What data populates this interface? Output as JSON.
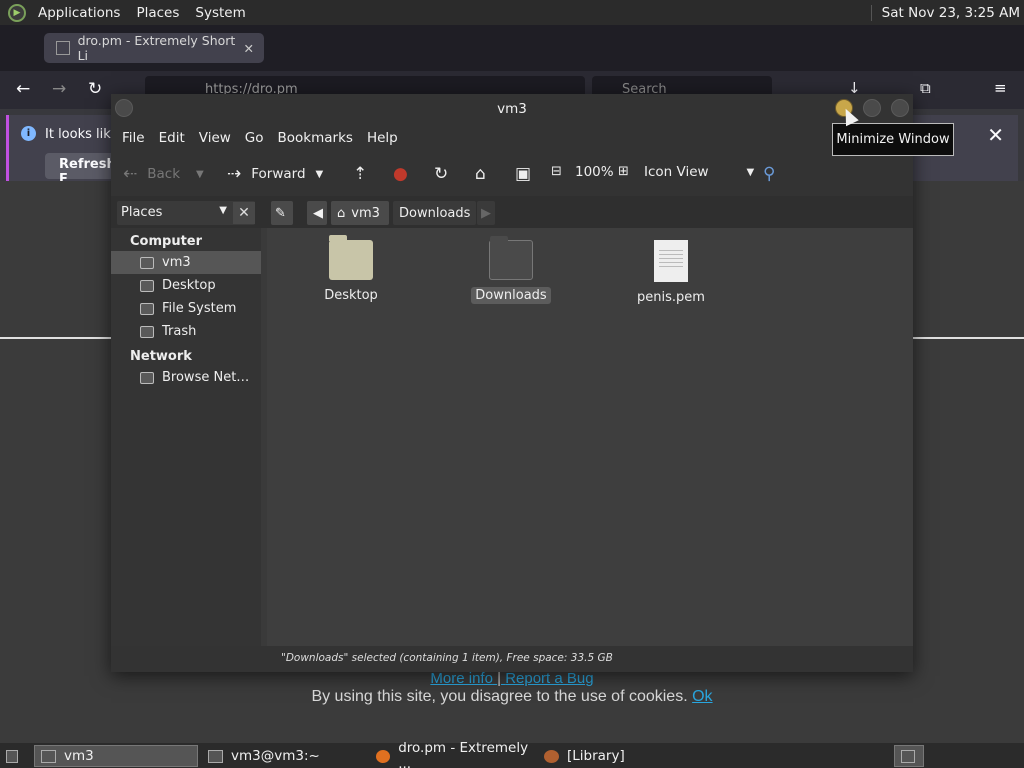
{
  "top_panel": {
    "menus": [
      "Applications",
      "Places",
      "System"
    ],
    "clock": "Sat Nov 23,  3:25 AM"
  },
  "browser": {
    "tab_title": "dro.pm - Extremely Short Li",
    "url": "https://dro.pm",
    "search_placeholder": "Search",
    "notice_text": "It looks like",
    "notice_button": "Refresh F",
    "links": {
      "more_info": "More info",
      "separator": "|",
      "report_bug": "Report a Bug"
    },
    "cookie_text": "By using this site, you disagree to the use of cookies.",
    "cookie_ok": "Ok"
  },
  "tooltip": "Minimize Window",
  "file_manager": {
    "title": "vm3",
    "menu": [
      "File",
      "Edit",
      "View",
      "Go",
      "Bookmarks",
      "Help"
    ],
    "toolbar": {
      "back": "Back",
      "forward": "Forward",
      "zoom": "100%",
      "view_mode": "Icon View"
    },
    "sidebar_selector": "Places",
    "breadcrumbs": [
      "vm3",
      "Downloads"
    ],
    "sidebar": {
      "computer_header": "Computer",
      "computer_items": [
        "vm3",
        "Desktop",
        "File System",
        "Trash"
      ],
      "network_header": "Network",
      "network_items": [
        "Browse Net…"
      ]
    },
    "files": [
      {
        "name": "Desktop",
        "kind": "folder"
      },
      {
        "name": "Downloads",
        "kind": "folder",
        "selected": true
      },
      {
        "name": "penis.pem",
        "kind": "document"
      }
    ],
    "status": "\"Downloads\" selected (containing 1 item), Free space: 33.5 GB"
  },
  "taskbar": {
    "tasks": [
      "vm3",
      "vm3@vm3:~",
      "dro.pm - Extremely ...",
      "[Library]"
    ]
  }
}
